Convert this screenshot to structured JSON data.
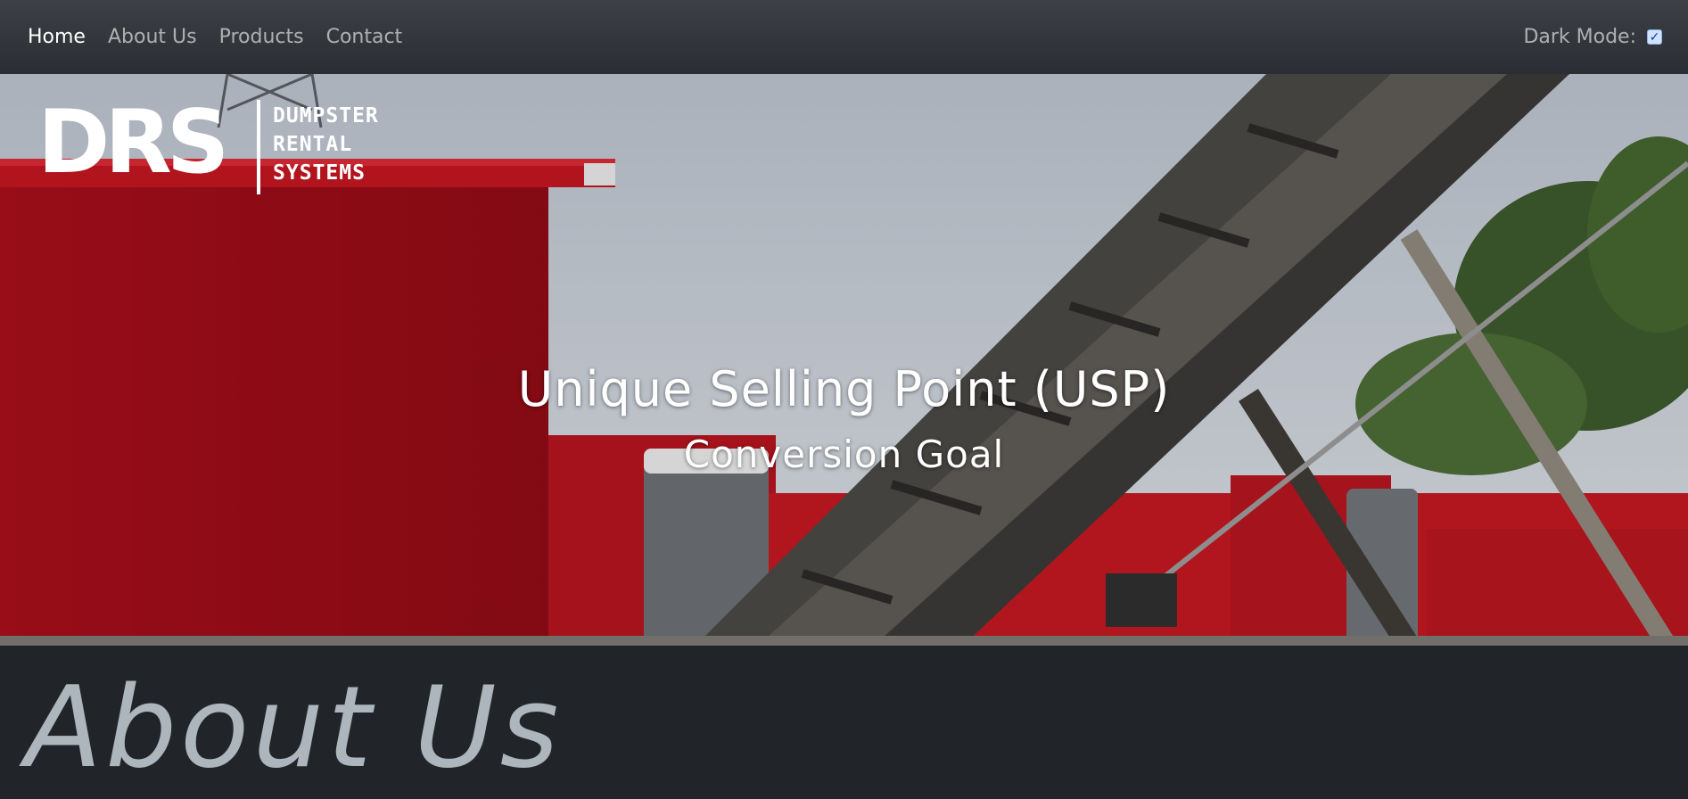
{
  "nav": {
    "links": [
      {
        "label": "Home",
        "active": true
      },
      {
        "label": "About Us",
        "active": false
      },
      {
        "label": "Products",
        "active": false
      },
      {
        "label": "Contact",
        "active": false
      }
    ],
    "dark_mode_label": "Dark Mode:",
    "dark_mode_checked": true
  },
  "hero": {
    "logo": {
      "mark": "DRS",
      "line1": "DUMPSTER",
      "line2": "RENTAL",
      "line3": "SYSTEMS"
    },
    "title": "Unique Selling Point (USP)",
    "subtitle": "Conversion Goal"
  },
  "about": {
    "heading": "About Us"
  },
  "colors": {
    "navbar": "#343a40",
    "page_background": "#212529",
    "dumpster_red": "#b0121d",
    "sky": "#c8ced6",
    "about_heading": "#adb5bd",
    "checkbox": "#cfe2ff"
  }
}
